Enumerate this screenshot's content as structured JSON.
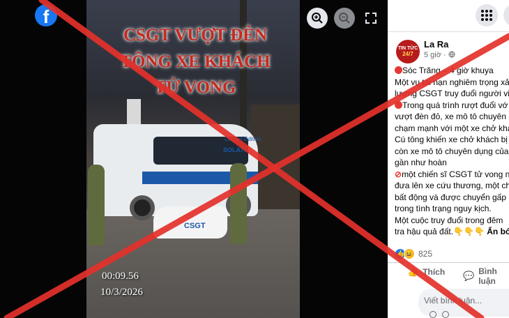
{
  "viewer": {
    "title_lines": [
      "CSGT VƯỢT ĐÈN",
      "TÔNG XE KHÁCH",
      "TỬ VONG"
    ],
    "timestamp_time": "00:09.56",
    "timestamp_date": "10/3/2026",
    "van_badge": "Limited Edition",
    "van_brand": "SOLATI",
    "bike_label": "CSGT",
    "icons": {
      "logo": "facebook-logo",
      "zoom_in": "zoom-in-icon",
      "zoom_out": "zoom-out-icon",
      "fullscreen": "fullscreen-icon"
    }
  },
  "post": {
    "author": "La Ra",
    "avatar_text": "TIN TỨC",
    "avatar_sub": "24/7",
    "time": "5 giờ ·",
    "lines": [
      "Sóc Trăng – 4 giờ khuya",
      "Một vụ tai nạn nghiêm trọng xả",
      "lượng CSGT truy đuổi người vi",
      "Trong quá trình rượt đuổi vớ",
      "vượt đèn đỏ, xe mô tô chuyên c",
      "chạm mạnh với một xe chở khá",
      "Cú tông khiến xe chở khách bị",
      "còn xe mô tô chuyên dụng của",
      "gần như hoàn",
      "một chiến sĩ CSGT tử vong n",
      "đưa lên xe cứu thương, một chi",
      "bất động và được chuyển gấp",
      "trong tình trạng nguy kịch.",
      "Một cuộc truy đuổi trong đêm",
      "tra hậu quả đất."
    ],
    "see_less": "Ẩn bớt",
    "reaction_count": "825",
    "like_label": "Thích",
    "comment_label": "Bình luận",
    "comment_placeholder": "Viết bình luận..."
  },
  "colors": {
    "facebook_blue": "#1877f2",
    "cross_red": "#e4312b",
    "overlay_title_red": "#c52a1f"
  }
}
